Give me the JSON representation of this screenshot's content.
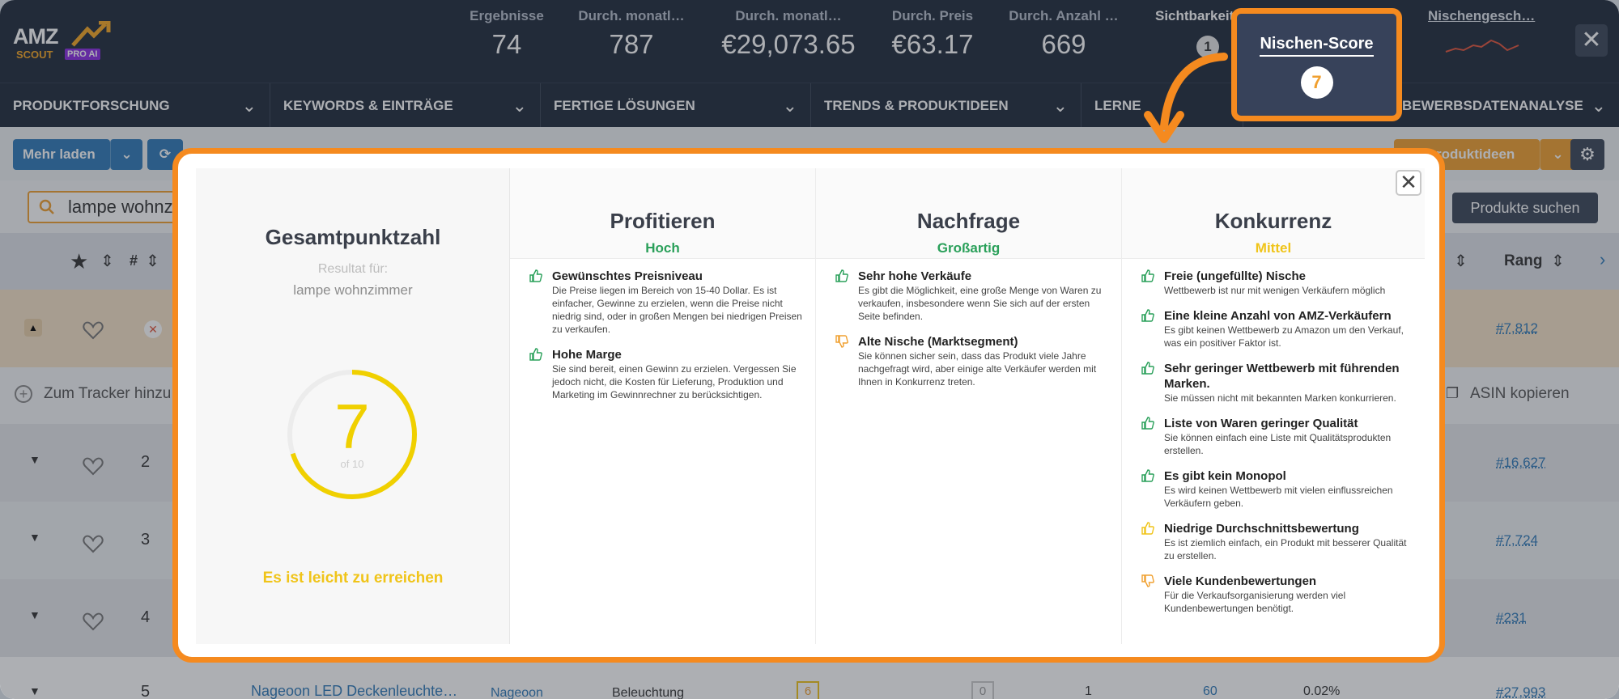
{
  "topbar": {
    "logo": {
      "amz": "AMZ",
      "scout": "SCOUT",
      "pro": "PRO AI"
    },
    "stats": [
      {
        "label": "Ergebnisse",
        "value": "74"
      },
      {
        "label": "Durch. monatl…",
        "value": "787"
      },
      {
        "label": "Durch. monatl…",
        "value": "€29,073.65"
      },
      {
        "label": "Durch. Preis",
        "value": "€63.17"
      },
      {
        "label": "Durch. Anzahl …",
        "value": "669"
      }
    ],
    "sichtbarkeit_label": "Sichtbarkeit",
    "sichtbarkeit_value": "1",
    "nischengesch_label": "Nischengesch…",
    "close": "✕"
  },
  "nav": [
    {
      "label": "PRODUKTFORSCHUNG"
    },
    {
      "label": "KEYWORDS & EINTRÄGE"
    },
    {
      "label": "FERTIGE LÖSUNGEN"
    },
    {
      "label": "TRENDS & PRODUKTIDEEN"
    },
    {
      "label": "LERNE"
    },
    {
      "label": "BEWERBSDATENANALYSE"
    }
  ],
  "toolbar": {
    "mehr_laden": "Mehr laden",
    "produktideen": "roduktideen"
  },
  "search": {
    "value": "lampe wohnzi",
    "button": "Produkte suchen"
  },
  "table": {
    "header_hash": "#",
    "header_rang": "Rang",
    "tracker": "Zum Tracker hinzu",
    "asin": "ASIN kopieren",
    "rows": [
      {
        "num": "",
        "rank": "#7,812"
      },
      {
        "num": "2",
        "rank": "#16,627"
      },
      {
        "num": "3",
        "rank": "#7,724"
      },
      {
        "num": "4",
        "rank": "#231"
      },
      {
        "num": "5",
        "rank": "#27,993",
        "title": "Nageoon LED Deckenleuchte…",
        "brand": "Nageoon",
        "category": "Beleuchtung",
        "score": "6",
        "zero": "0",
        "one": "1",
        "sixty": "60",
        "pct": "0.02%"
      }
    ]
  },
  "callout": {
    "title": "Nischen-Score",
    "score": "7"
  },
  "modal": {
    "close": "✕",
    "overall": {
      "title": "Gesamtpunktzahl",
      "result_for": "Resultat für:",
      "keyword": "lampe wohnzimmer",
      "score": "7",
      "max": "of 10",
      "score_fraction": 0.7,
      "verdict": "Es ist leicht zu erreichen"
    },
    "columns": [
      {
        "title": "Profitieren",
        "level": "Hoch",
        "level_color": "#2aa05a",
        "items": [
          {
            "icon": "thumbs-up",
            "title": "Gewünschtes Preisniveau",
            "desc": "Die Preise liegen im Bereich von 15-40 Dollar. Es ist einfacher, Gewinne zu erzielen, wenn die Preise nicht niedrig sind, oder in großen Mengen bei niedrigen Preisen zu verkaufen."
          },
          {
            "icon": "thumbs-up",
            "title": "Hohe Marge",
            "desc": "Sie sind bereit, einen Gewinn zu erzielen. Vergessen Sie jedoch nicht, die Kosten für Lieferung, Produktion und Marketing im Gewinnrechner zu berücksichtigen."
          }
        ]
      },
      {
        "title": "Nachfrage",
        "level": "Großartig",
        "level_color": "#2aa05a",
        "items": [
          {
            "icon": "thumbs-up",
            "title": "Sehr hohe Verkäufe",
            "desc": "Es gibt die Möglichkeit, eine große Menge von Waren zu verkaufen, insbesondere wenn Sie sich auf der ersten Seite befinden."
          },
          {
            "icon": "thumbs-down",
            "title": "Alte Nische (Marktsegment)",
            "desc": "Sie können sicher sein, dass das Produkt viele Jahre nachgefragt wird, aber einige alte Verkäufer werden mit Ihnen in Konkurrenz treten."
          }
        ]
      },
      {
        "title": "Konkurrenz",
        "level": "Mittel",
        "level_color": "#f0c419",
        "items": [
          {
            "icon": "thumbs-up",
            "title": "Freie (ungefüllte) Nische",
            "desc": "Wettbewerb ist nur mit wenigen Verkäufern möglich"
          },
          {
            "icon": "thumbs-up",
            "title": "Eine kleine Anzahl von AMZ-Verkäufern",
            "desc": "Es gibt keinen Wettbewerb zu Amazon um den Verkauf, was ein positiver Faktor ist."
          },
          {
            "icon": "thumbs-up",
            "title": "Sehr geringer Wettbewerb mit führenden Marken.",
            "desc": "Sie müssen nicht mit bekannten Marken konkurrieren."
          },
          {
            "icon": "thumbs-up",
            "title": "Liste von Waren geringer Qualität",
            "desc": "Sie können einfach eine Liste mit Qualitätsprodukten erstellen."
          },
          {
            "icon": "thumbs-up",
            "title": "Es gibt kein Monopol",
            "desc": "Es wird keinen Wettbewerb mit vielen einflussreichen Verkäufern geben."
          },
          {
            "icon": "thumbs-up-yellow",
            "title": "Niedrige Durchschnittsbewertung",
            "desc": "Es ist ziemlich einfach, ein Produkt mit besserer Qualität zu erstellen."
          },
          {
            "icon": "thumbs-down",
            "title": "Viele Kundenbewertungen",
            "desc": "Für die Verkaufsorganisierung werden viel Kundenbewertungen benötigt."
          }
        ]
      }
    ]
  },
  "colors": {
    "accent_orange": "#f58a1f",
    "dark_bg": "#202a3a",
    "green": "#2aa05a",
    "yellow": "#f0c419"
  }
}
